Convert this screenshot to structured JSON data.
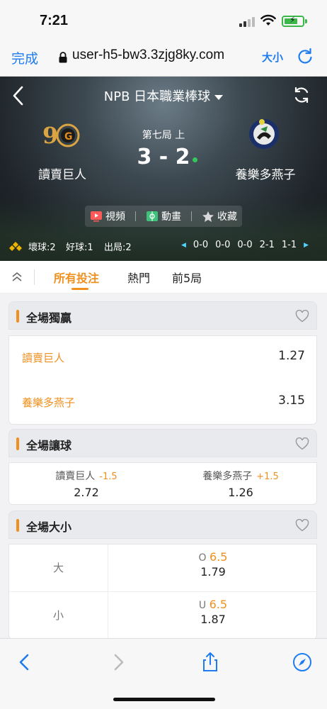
{
  "status_bar": {
    "time": "7:21"
  },
  "url_bar": {
    "done_label": "完成",
    "url": "user-h5-bw3.3zjg8ky.com",
    "text_size_label": "大小"
  },
  "header": {
    "league_title": "NPB 日本職業棒球",
    "home_team": "讀賣巨人",
    "away_team": "養樂多燕子",
    "inning": "第七局 上",
    "score": "3 - 2",
    "media": {
      "video_label": "視頻",
      "animation_label": "動畫",
      "favorite_label": "收藏"
    },
    "count": {
      "balls_label": "壞球:",
      "balls": "2",
      "strikes_label": "好球:",
      "strikes": "1",
      "outs_label": "出局:",
      "outs": "2"
    },
    "innings": [
      "0-0",
      "0-0",
      "0-0",
      "2-1",
      "1-1"
    ]
  },
  "tabs": [
    {
      "label": "所有投注",
      "active": true
    },
    {
      "label": "熱門",
      "active": false
    },
    {
      "label": "前5局",
      "active": false
    }
  ],
  "markets": {
    "moneyline": {
      "title": "全場獨贏",
      "rows": [
        {
          "team": "讀賣巨人",
          "odds": "1.27"
        },
        {
          "team": "養樂多燕子",
          "odds": "3.15"
        }
      ]
    },
    "handicap": {
      "title": "全場讓球",
      "cells": [
        {
          "team": "讀賣巨人",
          "line": "-1.5",
          "odds": "2.72"
        },
        {
          "team": "養樂多燕子",
          "line": "+1.5",
          "odds": "1.26"
        }
      ]
    },
    "total": {
      "title": "全場大小",
      "rows": [
        {
          "side": "大",
          "prefix": "O",
          "line": "6.5",
          "odds": "1.79"
        },
        {
          "side": "小",
          "prefix": "U",
          "line": "6.5",
          "odds": "1.87"
        }
      ]
    }
  },
  "colors": {
    "accent": "#f0901e",
    "ios_blue": "#1e7cf0",
    "live": "#34c759"
  }
}
